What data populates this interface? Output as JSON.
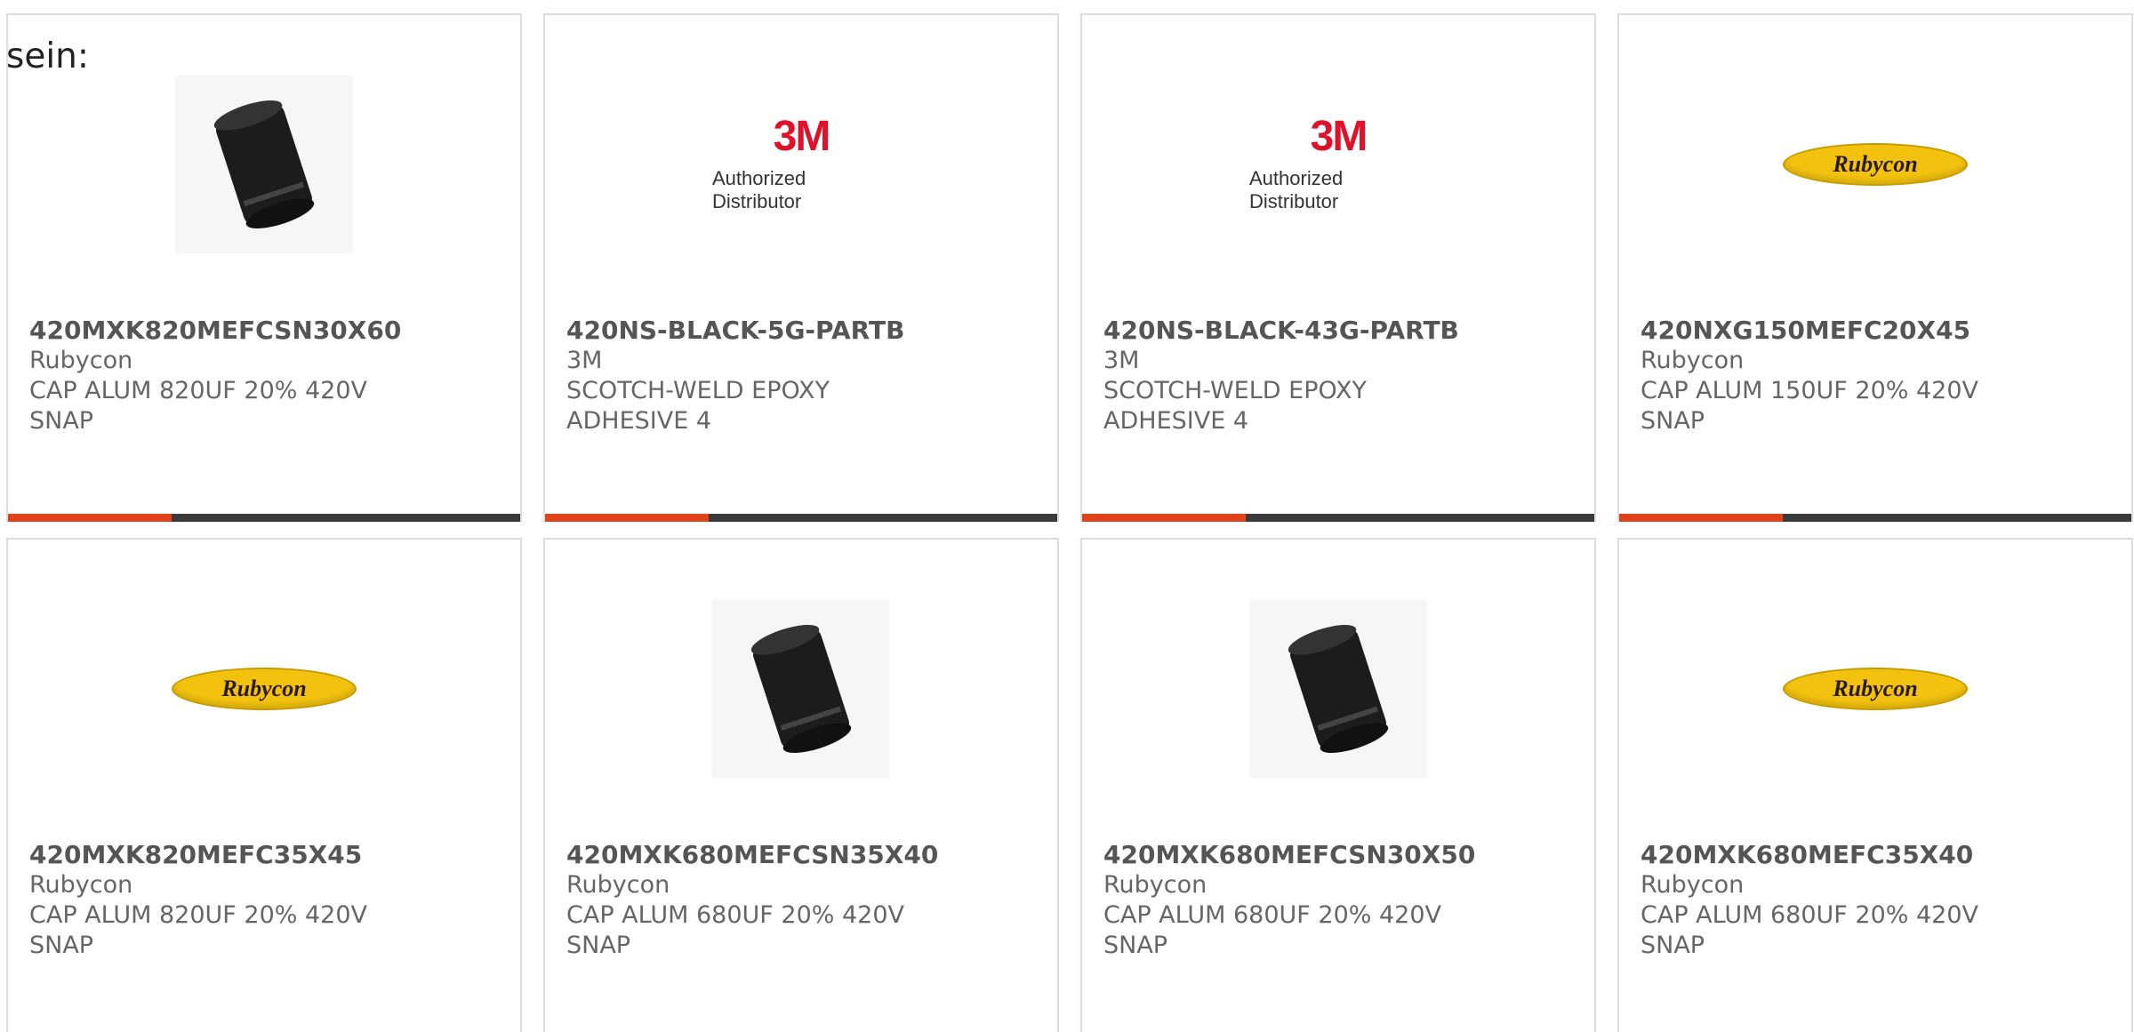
{
  "intro_text": "sein:",
  "colors": {
    "accent": "#e0431a",
    "bar_track": "#3a3a3a",
    "border": "#dddddd",
    "text": "#666666"
  },
  "products": [
    {
      "image": "capacitor-photo",
      "part_number": "420MXK820MEFCSN30X60",
      "manufacturer": "Rubycon",
      "description": "CAP ALUM 820UF 20% 420V SNAP",
      "progress": 0.32
    },
    {
      "image": "3m-logo",
      "logo_mark": "3M",
      "logo_sub": "Authorized Distributor",
      "part_number": "420NS-BLACK-5G-PARTB",
      "manufacturer": "3M",
      "description": "SCOTCH-WELD EPOXY ADHESIVE 4",
      "progress": 0.32
    },
    {
      "image": "3m-logo",
      "logo_mark": "3M",
      "logo_sub": "Authorized Distributor",
      "part_number": "420NS-BLACK-43G-PARTB",
      "manufacturer": "3M",
      "description": "SCOTCH-WELD EPOXY ADHESIVE 4",
      "progress": 0.32
    },
    {
      "image": "rubycon-logo",
      "logo_mark": "Rubycon",
      "part_number": "420NXG150MEFC20X45",
      "manufacturer": "Rubycon",
      "description": "CAP ALUM 150UF 20% 420V SNAP",
      "progress": 0.32
    },
    {
      "image": "rubycon-logo",
      "logo_mark": "Rubycon",
      "part_number": "420MXK820MEFC35X45",
      "manufacturer": "Rubycon",
      "description": "CAP ALUM 820UF 20% 420V SNAP"
    },
    {
      "image": "capacitor-photo",
      "part_number": "420MXK680MEFCSN35X40",
      "manufacturer": "Rubycon",
      "description": "CAP ALUM 680UF 20% 420V SNAP"
    },
    {
      "image": "capacitor-photo",
      "part_number": "420MXK680MEFCSN30X50",
      "manufacturer": "Rubycon",
      "description": "CAP ALUM 680UF 20% 420V SNAP"
    },
    {
      "image": "rubycon-logo",
      "logo_mark": "Rubycon",
      "part_number": "420MXK680MEFC35X40",
      "manufacturer": "Rubycon",
      "description": "CAP ALUM 680UF 20% 420V SNAP"
    }
  ]
}
